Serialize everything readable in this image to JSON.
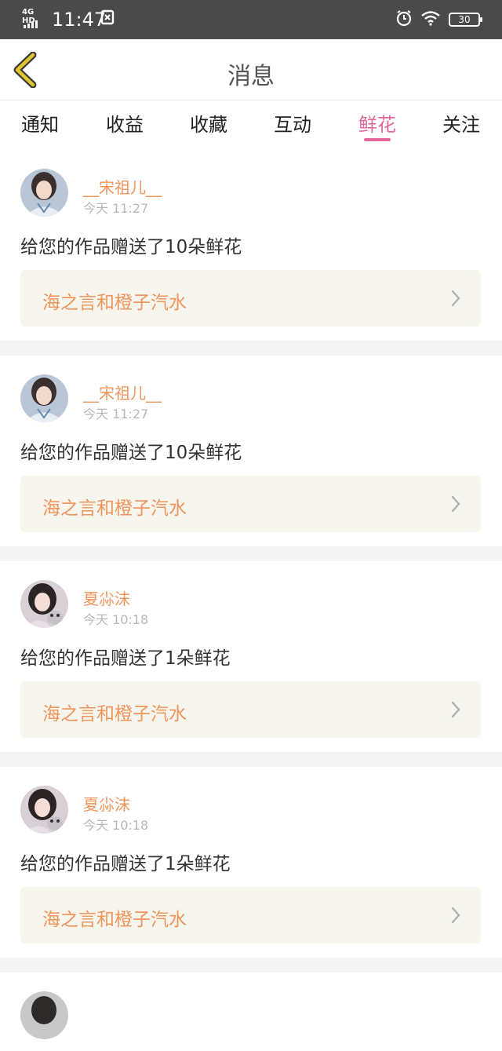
{
  "status_bar": {
    "network": "4G HD",
    "time": "11:47",
    "battery": "30",
    "icons": [
      "signal-icon",
      "notification-icon",
      "alarm-icon",
      "wifi-icon",
      "battery-icon"
    ]
  },
  "header": {
    "title": "消息",
    "back_icon": "chevron-left-icon",
    "accent_color": "#e0c531"
  },
  "tabs": [
    {
      "label": "通知",
      "active": false
    },
    {
      "label": "收益",
      "active": false
    },
    {
      "label": "收藏",
      "active": false
    },
    {
      "label": "互动",
      "active": false
    },
    {
      "label": "鲜花",
      "active": true
    },
    {
      "label": "关注",
      "active": false
    }
  ],
  "colors": {
    "active_tab": "#e3679a",
    "username": "#f0955b",
    "work_box_bg": "#f6f6ef"
  },
  "messages": [
    {
      "username": "__宋祖儿__",
      "time": "今天 11:27",
      "text": "给您的作品赠送了10朵鲜花",
      "work_title": "海之言和橙子汽水",
      "avatar": "avatar-image"
    },
    {
      "username": "__宋祖儿__",
      "time": "今天 11:27",
      "text": "给您的作品赠送了10朵鲜花",
      "work_title": "海之言和橙子汽水",
      "avatar": "avatar-image"
    },
    {
      "username": "夏尛沫",
      "time": "今天 10:18",
      "text": "给您的作品赠送了1朵鲜花",
      "work_title": "海之言和橙子汽水",
      "avatar": "avatar-image"
    },
    {
      "username": "夏尛沫",
      "time": "今天 10:18",
      "text": "给您的作品赠送了1朵鲜花",
      "work_title": "海之言和橙子汽水",
      "avatar": "avatar-image"
    }
  ]
}
